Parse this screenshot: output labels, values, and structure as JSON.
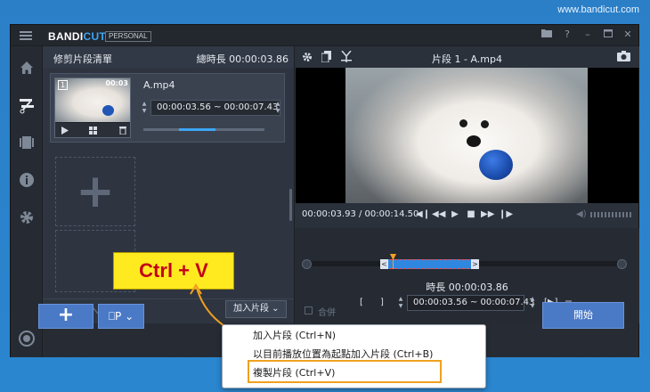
{
  "watermark": "www.bandicut.com",
  "titlebar": {
    "brand_main": "BANDI",
    "brand_accent": "CUT",
    "edition": "PERSONAL"
  },
  "clip_list": {
    "title": "修剪片段清單",
    "total_duration": "總時長 00:00:03.86",
    "clips": [
      {
        "index": "1",
        "thumb_time": "00:03",
        "filename": "A.mp4",
        "range": "00:00:03.56 ~ 00:00:07.43",
        "progress": 0.3
      }
    ],
    "add_clip_dropdown": "加入片段 ⌄"
  },
  "preview": {
    "title": "片段 1 - A.mp4",
    "time_readout": "00:00:03.93 / 00:00:14.50",
    "duration_label": "時長 00:00:03.86",
    "start_bracket": "[",
    "end_bracket": "]",
    "range": "00:00:03.56 ~ 00:00:07.43",
    "merge_label": "合併"
  },
  "bottom": {
    "add_label": "+",
    "view_label": "⎕P ⌄",
    "start_label": "開始"
  },
  "context_menu": {
    "items": [
      "加入片段 (Ctrl+N)",
      "以目前播放位置為起點加入片段 (Ctrl+B)",
      "複製片段 (Ctrl+V)"
    ],
    "highlighted_index": 2
  },
  "callout": {
    "text": "Ctrl + V"
  },
  "colors": {
    "background": "#2a86cf",
    "window": "#2b313b",
    "accent": "#3da5f4",
    "button_blue": "#4a79c6",
    "highlight_border": "#f0a020",
    "callout_bg": "#ffea20",
    "callout_text": "#c40018"
  }
}
